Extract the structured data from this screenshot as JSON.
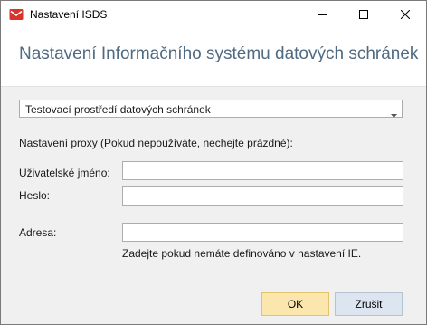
{
  "window": {
    "title": "Nastavení ISDS",
    "controls": {
      "minimize_icon": "minimize-icon",
      "maximize_icon": "maximize-icon",
      "close_icon": "close-icon"
    }
  },
  "header": {
    "title": "Nastavení Informačního systému datových schránek"
  },
  "environment": {
    "selected": "Testovací prostředí datových schránek"
  },
  "proxy": {
    "section_label": "Nastavení proxy (Pokud nepoužíváte, nechejte prázdné):",
    "username_label": "Uživatelské jméno:",
    "username_value": "",
    "password_label": "Heslo:",
    "password_value": "",
    "address_label": "Adresa:",
    "address_value": "",
    "address_hint": "Zadejte pokud nemáte definováno v nastavení IE."
  },
  "buttons": {
    "ok": "OK",
    "cancel": "Zrušit"
  },
  "colors": {
    "heading": "#4f6a82",
    "app_icon": "#d9342b",
    "ok_button": "#fbe6ad",
    "cancel_button": "#dde6f0"
  }
}
